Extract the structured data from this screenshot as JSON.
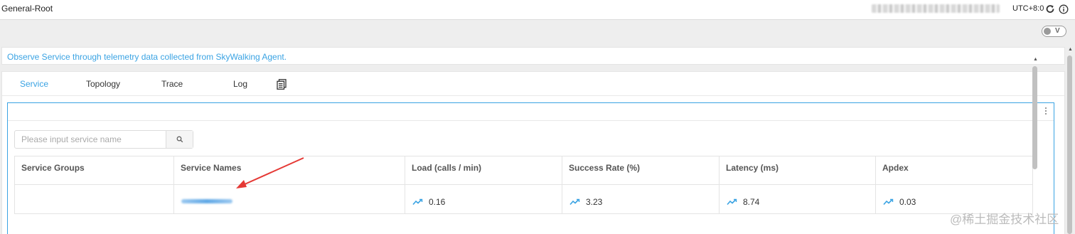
{
  "header": {
    "title": "General-Root",
    "timezone": "UTC+8:0",
    "reload_icon": "reload-icon",
    "info_icon": "info-icon"
  },
  "toggle": {
    "label": "V",
    "state": "off"
  },
  "description": "Observe Service through telemetry data collected from SkyWalking Agent.",
  "tabs": [
    {
      "label": "Service",
      "active": true
    },
    {
      "label": "Topology",
      "active": false
    },
    {
      "label": "Trace",
      "active": false
    },
    {
      "label": "Log",
      "active": false
    }
  ],
  "search": {
    "placeholder": "Please input service name",
    "value": ""
  },
  "table": {
    "headers": [
      "Service Groups",
      "Service Names",
      "Load (calls / min)",
      "Success Rate (%)",
      "Latency (ms)",
      "Apdex"
    ],
    "rows": [
      {
        "group": "",
        "load": "0.16",
        "success_rate": "3.23",
        "latency": "8.74",
        "apdex": "0.03"
      }
    ]
  },
  "watermark": "@稀土掘金技术社区",
  "colors": {
    "accent": "#3aa3e3",
    "annotation_arrow": "#e53935"
  }
}
